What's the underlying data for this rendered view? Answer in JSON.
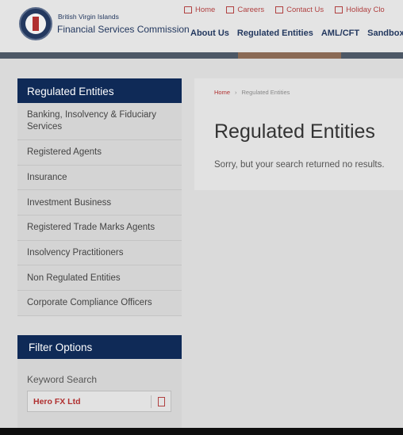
{
  "header": {
    "logo": {
      "small": "British Virgin Islands",
      "big": "Financial Services Commission"
    },
    "top_links": [
      {
        "label": "Home",
        "icon": "home-icon"
      },
      {
        "label": "Careers",
        "icon": "briefcase-icon"
      },
      {
        "label": "Contact Us",
        "icon": "mail-icon"
      },
      {
        "label": "Holiday Clo",
        "icon": "calendar-icon"
      }
    ],
    "nav": [
      "About Us",
      "Regulated Entities",
      "AML/CFT",
      "Sandbox"
    ]
  },
  "sidebar": {
    "title": "Regulated Entities",
    "items": [
      "Banking, Insolvency & Fiduciary Services",
      "Registered Agents",
      "Insurance",
      "Investment Business",
      "Registered Trade Marks Agents",
      "Insolvency Practitioners",
      "Non Regulated Entities",
      "Corporate Compliance Officers"
    ]
  },
  "filter": {
    "title": "Filter Options",
    "keyword_label": "Keyword Search",
    "keyword_value": "Hero FX Ltd"
  },
  "main": {
    "breadcrumb": {
      "home": "Home",
      "separator": "›",
      "current": "Regulated Entities"
    },
    "title": "Regulated Entities",
    "message": "Sorry, but your search returned no results."
  },
  "colors": {
    "navy": "#0f2a57",
    "accent_red": "#b03030"
  }
}
